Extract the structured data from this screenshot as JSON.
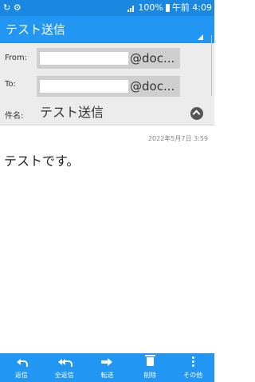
{
  "status_bar": {
    "left_icons": "↻ ⚙",
    "battery": "100%",
    "time": "午前 4:09"
  },
  "header": {
    "title": "テスト送信"
  },
  "address": {
    "from_label": "From:",
    "from_domain": "@doc...",
    "to_label": "To:",
    "to_domain": "@doc...",
    "subject_label": "件名:",
    "subject": "テスト送信"
  },
  "message": {
    "timestamp": "2022年5月7日 3:59",
    "body": "テストです。"
  },
  "toolbar": {
    "reply": "返信",
    "reply_all": "全返信",
    "forward": "転送",
    "delete": "削除",
    "more": "その他"
  },
  "colors": {
    "accent": "#2196f3",
    "status_bar": "#1a88e0",
    "address_bg": "#ececec"
  }
}
